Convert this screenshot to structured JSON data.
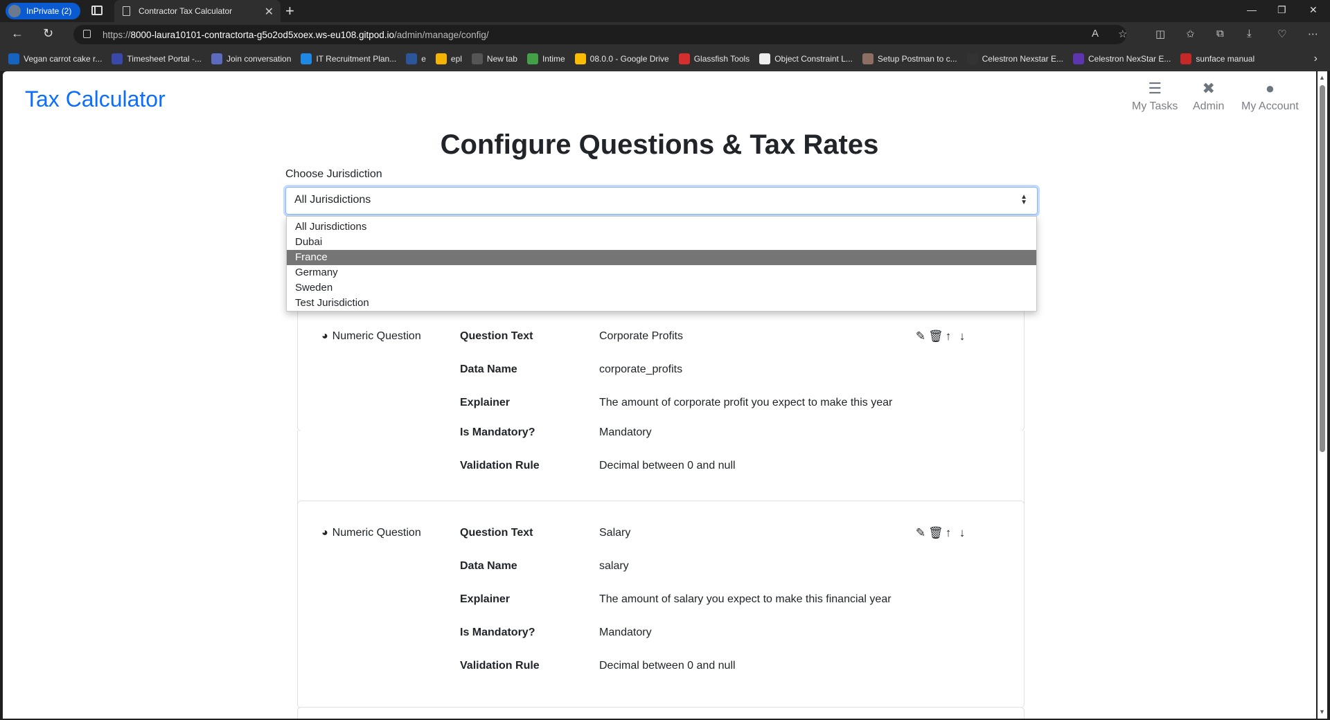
{
  "browser": {
    "profile_label": "InPrivate (2)",
    "tab_title": "Contractor Tax Calculator",
    "url_prefix": "https://",
    "url_host": "8000-laura10101-contractorta-g5o2od5xoex.ws-eu108.gitpod.io",
    "url_path": "/admin/manage/config/",
    "bookmarks": [
      {
        "label": "Vegan carrot cake r...",
        "color": "#1565c0"
      },
      {
        "label": "Timesheet Portal -...",
        "color": "#3949ab"
      },
      {
        "label": "Join conversation",
        "color": "#5c6bc0"
      },
      {
        "label": "IT Recruitment Plan...",
        "color": "#1e88e5"
      },
      {
        "label": "e",
        "color": "#2b579a"
      },
      {
        "label": "epl",
        "color": "#f4b400"
      },
      {
        "label": "New tab",
        "color": "#555555"
      },
      {
        "label": "Intime",
        "color": "#43a047"
      },
      {
        "label": "08.0.0 - Google Drive",
        "color": "#fbbc04"
      },
      {
        "label": "Glassfish Tools",
        "color": "#d32f2f"
      },
      {
        "label": "Object Constraint L...",
        "color": "#eeeeee"
      },
      {
        "label": "Setup Postman to c...",
        "color": "#8d6e63"
      },
      {
        "label": "Celestron Nexstar E...",
        "color": "#333333"
      },
      {
        "label": "Celestron NexStar E...",
        "color": "#5e35b1"
      },
      {
        "label": "sunface manual",
        "color": "#c62828"
      }
    ]
  },
  "app": {
    "brand": "Tax Calculator",
    "nav": [
      {
        "label": "My Tasks",
        "icon": "list-icon"
      },
      {
        "label": "Admin",
        "icon": "tools-icon"
      },
      {
        "label": "My Account",
        "icon": "user-icon"
      }
    ],
    "title": "Configure Questions & Tax Rates",
    "jurisdiction_label": "Choose Jurisdiction",
    "jurisdiction_selected": "All Jurisdictions",
    "jurisdiction_options": [
      "All Jurisdictions",
      "Dubai",
      "France",
      "Germany",
      "Sweden",
      "Test Jurisdiction"
    ],
    "highlighted_option": "France"
  },
  "questions": [
    {
      "type": "Numeric Question",
      "rows": [
        {
          "label": "Question Text",
          "value": "Corporate Profits"
        },
        {
          "label": "Data Name",
          "value": "corporate_profits"
        },
        {
          "label": "Explainer",
          "value": "The amount of corporate profit you expect to make this year"
        },
        {
          "label": "Is Mandatory?",
          "value": "Mandatory"
        },
        {
          "label": "Validation Rule",
          "value": "Decimal between 0 and null"
        }
      ]
    },
    {
      "type": "Numeric Question",
      "rows": [
        {
          "label": "Question Text",
          "value": "Salary"
        },
        {
          "label": "Data Name",
          "value": "salary"
        },
        {
          "label": "Explainer",
          "value": "The amount of salary you expect to make this financial year"
        },
        {
          "label": "Is Mandatory?",
          "value": "Mandatory"
        },
        {
          "label": "Validation Rule",
          "value": "Decimal between 0 and null"
        }
      ]
    }
  ]
}
